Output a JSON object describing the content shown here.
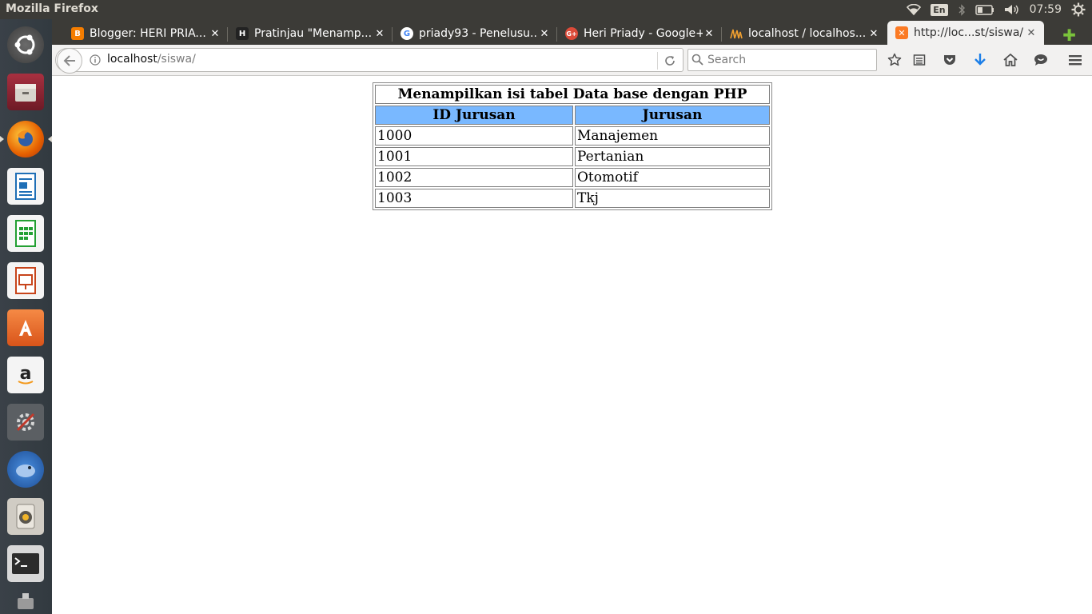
{
  "system": {
    "window_title": "Mozilla Firefox",
    "keyboard_layout": "En",
    "clock": "07:59"
  },
  "launcher": {
    "items": [
      {
        "name": "dash-icon",
        "color": "#4a4a4a"
      },
      {
        "name": "files-icon",
        "color": "#8a2030"
      },
      {
        "name": "firefox-icon",
        "color": "#e66000"
      },
      {
        "name": "writer-icon",
        "color": "#1f6fb6"
      },
      {
        "name": "calc-icon",
        "color": "#23a033"
      },
      {
        "name": "impress-icon",
        "color": "#c7441b"
      },
      {
        "name": "software-center-icon",
        "color": "#e8682a"
      },
      {
        "name": "amazon-icon",
        "color": "#f4f4f4"
      },
      {
        "name": "system-settings-icon",
        "color": "#5b5f63"
      },
      {
        "name": "thunderbird-icon",
        "color": "#2d6fc4"
      },
      {
        "name": "rhythmbox-icon",
        "color": "#d0ccc4"
      },
      {
        "name": "terminal-icon",
        "color": "#2b2b2b"
      }
    ]
  },
  "tabs": [
    {
      "label": "Blogger: HERI PRIA...",
      "favicon_color": "#f57d00",
      "favicon": "B",
      "active": false
    },
    {
      "label": "Pratinjau \"Menamp...",
      "favicon_color": "#222222",
      "favicon": "H",
      "active": false
    },
    {
      "label": "priady93 - Penelusu...",
      "favicon_color": "#ffffff",
      "favicon": "G",
      "active": false
    },
    {
      "label": "Heri Priady - Google+",
      "favicon_color": "#dd4b39",
      "favicon": "G+",
      "active": false
    },
    {
      "label": "localhost / localhos...",
      "favicon_color": "#f0a030",
      "favicon": "PMA",
      "active": false
    },
    {
      "label": "http://loc...st/siswa/",
      "favicon_color": "#fb7a24",
      "favicon": "X",
      "active": true
    }
  ],
  "navbar": {
    "url_host": "localhost",
    "url_path": "/siswa/",
    "search_placeholder": "Search"
  },
  "page": {
    "table_title": "Menampilkan isi tabel Data base dengan PHP",
    "columns": [
      "ID Jurusan",
      "Jurusan"
    ],
    "rows": [
      [
        "1000",
        "Manajemen"
      ],
      [
        "1001",
        "Pertanian"
      ],
      [
        "1002",
        "Otomotif"
      ],
      [
        "1003",
        "Tkj"
      ]
    ]
  }
}
